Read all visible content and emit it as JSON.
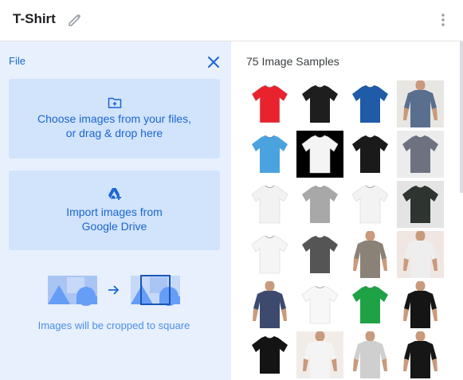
{
  "header": {
    "title": "T-Shirt",
    "edit_icon": "pencil-icon",
    "more_icon": "more-vert-icon"
  },
  "upload_panel": {
    "section_label": "File",
    "close_icon": "close-icon",
    "file_upload": {
      "icon": "add-folder-icon",
      "line1": "Choose images from your files,",
      "line2": "or drag & drop here"
    },
    "drive_import": {
      "icon": "google-drive-add-icon",
      "line1": "Import images from",
      "line2": "Google Drive"
    },
    "crop_hint": "Images will be cropped to square"
  },
  "samples": {
    "title": "75 Image Samples",
    "images": [
      {
        "shirt": "#e8232e",
        "bg": "#ffffff",
        "kind": "flat"
      },
      {
        "shirt": "#1e1e1e",
        "bg": "#ffffff",
        "kind": "flat"
      },
      {
        "shirt": "#1f5ba6",
        "bg": "#ffffff",
        "kind": "flat"
      },
      {
        "shirt": "#5a6f8e",
        "bg": "#e8e6e3",
        "kind": "person"
      },
      {
        "shirt": "#4aa3df",
        "bg": "#ffffff",
        "kind": "flat"
      },
      {
        "shirt": "#f4f4f4",
        "bg": "#000000",
        "kind": "flat"
      },
      {
        "shirt": "#1a1a1a",
        "bg": "#ffffff",
        "kind": "flat"
      },
      {
        "shirt": "#6e7280",
        "bg": "#ececec",
        "kind": "flat"
      },
      {
        "shirt": "#f2f2f2",
        "bg": "#ffffff",
        "kind": "flat"
      },
      {
        "shirt": "#a8a8a8",
        "bg": "#ffffff",
        "kind": "flat"
      },
      {
        "shirt": "#f3f3f3",
        "bg": "#ffffff",
        "kind": "flat"
      },
      {
        "shirt": "#2e3430",
        "bg": "#e4e4e4",
        "kind": "flat"
      },
      {
        "shirt": "#f5f5f5",
        "bg": "#ffffff",
        "kind": "flat"
      },
      {
        "shirt": "#555555",
        "bg": "#ffffff",
        "kind": "flat"
      },
      {
        "shirt": "#8a8276",
        "bg": "#ffffff",
        "kind": "person"
      },
      {
        "shirt": "#eeeeee",
        "bg": "#f0e6e2",
        "kind": "person"
      },
      {
        "shirt": "#3d4a6e",
        "bg": "#ffffff",
        "kind": "person"
      },
      {
        "shirt": "#f7f7f7",
        "bg": "#ffffff",
        "kind": "flat"
      },
      {
        "shirt": "#1fa245",
        "bg": "#ffffff",
        "kind": "flat"
      },
      {
        "shirt": "#151515",
        "bg": "#ffffff",
        "kind": "person"
      },
      {
        "shirt": "#141414",
        "bg": "#ffffff",
        "kind": "flat"
      },
      {
        "shirt": "#f4f4f4",
        "bg": "#f1ece8",
        "kind": "person"
      },
      {
        "shirt": "#cfcfcf",
        "bg": "#ffffff",
        "kind": "person"
      },
      {
        "shirt": "#161616",
        "bg": "#ffffff",
        "kind": "person"
      }
    ]
  },
  "colors": {
    "accent": "#1967d2",
    "panel_bg": "#e8f0fe",
    "card_bg": "#d2e3fc"
  }
}
